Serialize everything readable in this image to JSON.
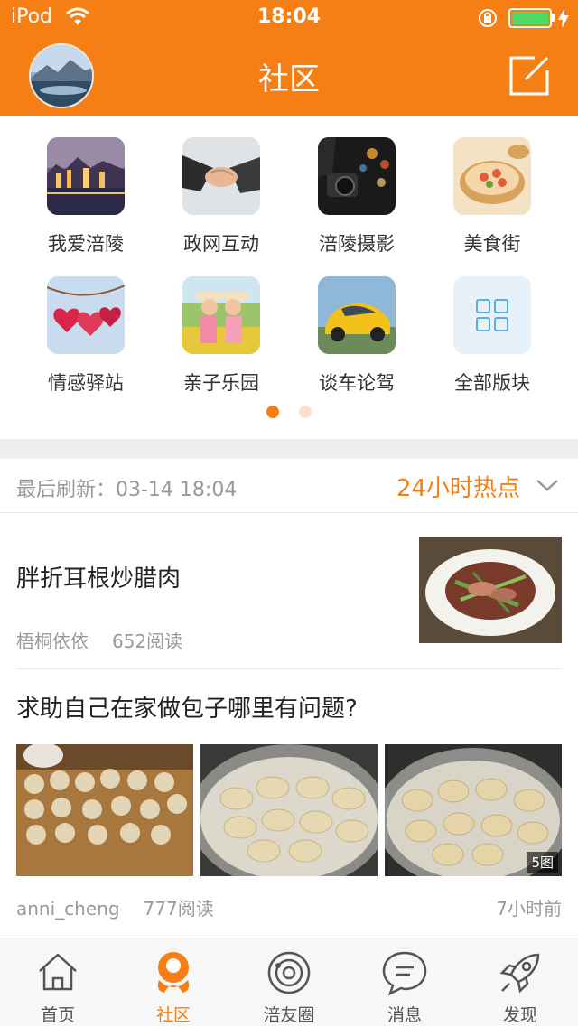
{
  "status_bar": {
    "carrier": "iPod",
    "time": "18:04"
  },
  "header": {
    "title": "社区"
  },
  "categories": [
    {
      "label": "我爱涪陵"
    },
    {
      "label": "政网互动"
    },
    {
      "label": "涪陵摄影"
    },
    {
      "label": "美食街"
    },
    {
      "label": "情感驿站"
    },
    {
      "label": "亲子乐园"
    },
    {
      "label": "谈车论驾"
    },
    {
      "label": "全部版块"
    }
  ],
  "pager": {
    "total": 2,
    "active": 0
  },
  "feed": {
    "last_refresh": "最后刷新：03-14   18:04",
    "hot_label": "24小时热点",
    "posts": [
      {
        "title": "胖折耳根炒腊肉",
        "author": "梧桐依依",
        "reads": "652阅读"
      },
      {
        "title": "求助自己在家做包子哪里有问题?",
        "author": "anni_cheng",
        "reads": "777阅读",
        "image_count": "5图",
        "time": "7小时前"
      }
    ]
  },
  "tabbar": {
    "tabs": [
      {
        "label": "首页",
        "icon": "home-icon"
      },
      {
        "label": "社区",
        "icon": "community-icon",
        "active": true
      },
      {
        "label": "涪友圈",
        "icon": "planet-icon"
      },
      {
        "label": "消息",
        "icon": "message-icon"
      },
      {
        "label": "发现",
        "icon": "rocket-icon"
      }
    ]
  },
  "colors": {
    "accent": "#f57f14",
    "battery": "#4cd964"
  }
}
